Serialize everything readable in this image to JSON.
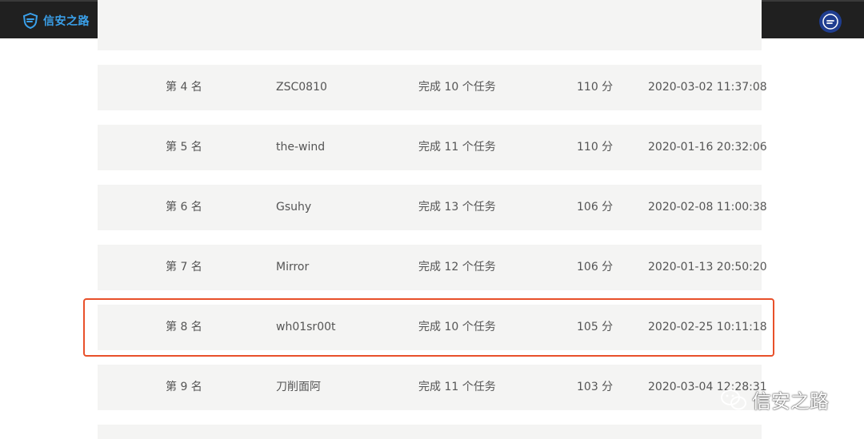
{
  "header": {
    "logo_text": "信安之路",
    "logo_icon": "shield-logo-icon",
    "avatar_icon": "user-avatar-icon"
  },
  "colors": {
    "topbar": "#202020",
    "brand": "#3aa0ea",
    "row_bg": "#f4f4f3",
    "highlight": "#e8502a"
  },
  "rows": [
    {
      "rank": "",
      "name": "",
      "tasks": "",
      "score": "",
      "time": ""
    },
    {
      "rank": "第 4 名",
      "name": "ZSC0810",
      "tasks": "完成 10 个任务",
      "score": "110 分",
      "time": "2020-03-02 11:37:08"
    },
    {
      "rank": "第 5 名",
      "name": "the-wind",
      "tasks": "完成 11 个任务",
      "score": "110 分",
      "time": "2020-01-16 20:32:06"
    },
    {
      "rank": "第 6 名",
      "name": "Gsuhy",
      "tasks": "完成 13 个任务",
      "score": "106 分",
      "time": "2020-02-08 11:00:38"
    },
    {
      "rank": "第 7 名",
      "name": "Mirror",
      "tasks": "完成 12 个任务",
      "score": "106 分",
      "time": "2020-01-13 20:50:20"
    },
    {
      "rank": "第 8 名",
      "name": "wh01sr00t",
      "tasks": "完成 10 个任务",
      "score": "105 分",
      "time": "2020-02-25 10:11:18"
    },
    {
      "rank": "第 9 名",
      "name": "刀削面阿",
      "tasks": "完成 11 个任务",
      "score": "103 分",
      "time": "2020-03-04 12:28:31"
    },
    {
      "rank": "",
      "name": "",
      "tasks": "",
      "score": "",
      "time": ""
    }
  ],
  "watermark": {
    "text": "信安之路",
    "icon": "wechat-icon"
  }
}
